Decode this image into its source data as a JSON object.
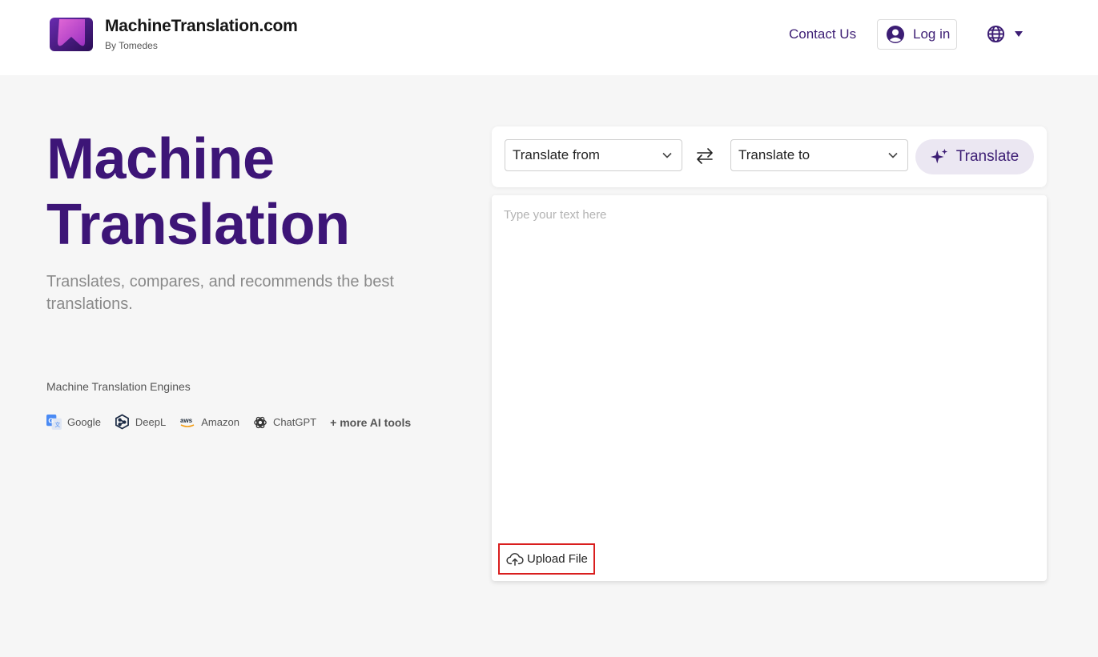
{
  "header": {
    "brand_title": "MachineTranslation.com",
    "brand_subtitle": "By Tomedes",
    "contact_label": "Contact Us",
    "login_label": "Log in",
    "language_icon": "globe-icon"
  },
  "hero": {
    "title_line1": "Machine",
    "title_line2": "Translation",
    "subtitle": "Translates, compares, and recommends the best translations.",
    "engines_label": "Machine Translation Engines",
    "engines": [
      {
        "name": "Google",
        "icon": "google-translate-icon"
      },
      {
        "name": "DeepL",
        "icon": "deepl-icon"
      },
      {
        "name": "Amazon",
        "icon": "aws-icon"
      },
      {
        "name": "ChatGPT",
        "icon": "chatgpt-icon"
      }
    ],
    "more_tools": "+ more AI tools"
  },
  "toolbar": {
    "from_label": "Translate from",
    "to_label": "Translate to",
    "translate_label": "Translate"
  },
  "editor": {
    "placeholder": "Type your text here",
    "upload_label": "Upload File"
  },
  "colors": {
    "brand_purple": "#3d1577",
    "accent_purple": "#3c1d74",
    "translate_bg": "#ebe7f2",
    "highlight_red": "#d91e1e"
  }
}
